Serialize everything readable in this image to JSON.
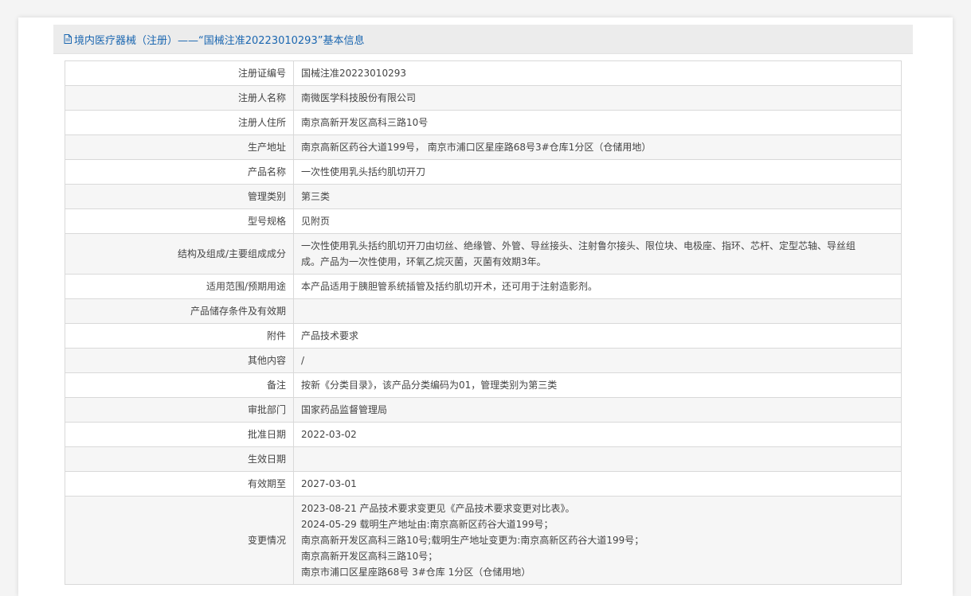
{
  "header": {
    "title": "境内医疗器械（注册）——“国械注准20223010293”基本信息"
  },
  "rows": [
    {
      "label": "注册证编号",
      "value": [
        "国械注准20223010293"
      ]
    },
    {
      "label": "注册人名称",
      "value": [
        "南微医学科技股份有限公司"
      ]
    },
    {
      "label": "注册人住所",
      "value": [
        "南京高新开发区高科三路10号"
      ]
    },
    {
      "label": "生产地址",
      "value": [
        "南京高新区药谷大道199号， 南京市浦口区星座路68号3#仓库1分区（仓储用地）"
      ]
    },
    {
      "label": "产品名称",
      "value": [
        "一次性使用乳头括约肌切开刀"
      ]
    },
    {
      "label": "管理类别",
      "value": [
        "第三类"
      ]
    },
    {
      "label": "型号规格",
      "value": [
        "见附页"
      ]
    },
    {
      "label": "结构及组成/主要组成成分",
      "value": [
        "一次性使用乳头括约肌切开刀由切丝、绝缘管、外管、导丝接头、注射鲁尔接头、限位块、电极座、指环、芯杆、定型芯轴、导丝组",
        "成。产品为一次性使用，环氧乙烷灭菌，灭菌有效期3年。"
      ]
    },
    {
      "label": "适用范围/预期用途",
      "value": [
        "本产品适用于胰胆管系统插管及括约肌切开术，还可用于注射造影剂。"
      ]
    },
    {
      "label": "产品储存条件及有效期",
      "value": [
        ""
      ]
    },
    {
      "label": "附件",
      "value": [
        "产品技术要求"
      ]
    },
    {
      "label": "其他内容",
      "value": [
        "/"
      ]
    },
    {
      "label": "备注",
      "value": [
        "按新《分类目录》，该产品分类编码为01，管理类别为第三类"
      ]
    },
    {
      "label": "审批部门",
      "value": [
        "国家药品监督管理局"
      ]
    },
    {
      "label": "批准日期",
      "value": [
        "2022-03-02"
      ]
    },
    {
      "label": "生效日期",
      "value": [
        ""
      ]
    },
    {
      "label": "有效期至",
      "value": [
        "2027-03-01"
      ]
    },
    {
      "label": "变更情况",
      "value": [
        "2023-08-21 产品技术要求变更见《产品技术要求变更对比表》。",
        "2024-05-29 载明生产地址由:南京高新区药谷大道199号；",
        "南京高新开发区高科三路10号;载明生产地址变更为:南京高新区药谷大道199号；",
        "南京高新开发区高科三路10号；",
        "南京市浦口区星座路68号 3#仓库 1分区（仓储用地）"
      ]
    }
  ]
}
